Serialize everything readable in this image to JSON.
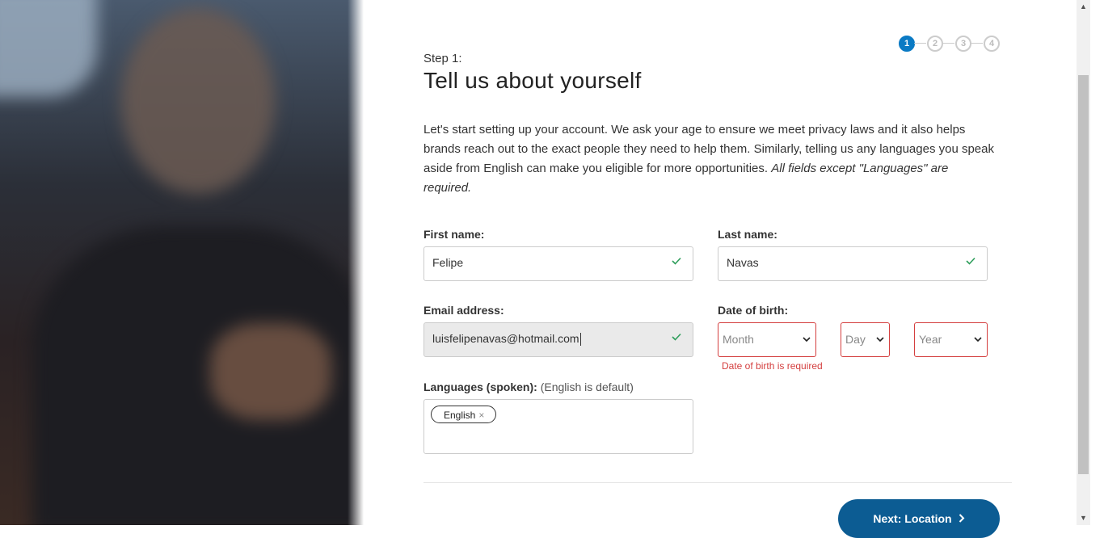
{
  "stepper": {
    "steps": [
      "1",
      "2",
      "3",
      "4"
    ],
    "active": 1
  },
  "header": {
    "step_label": "Step 1:",
    "title": "Tell us about yourself"
  },
  "intro": {
    "text": "Let's start setting up your account. We ask your age to ensure we meet privacy laws and it also helps brands reach out to the exact people they need to help them. Similarly, telling us any languages you speak aside from English can make you eligible for more opportunities.",
    "emphasis": "All fields except \"Languages\" are required."
  },
  "form": {
    "first_name": {
      "label": "First name:",
      "value": "Felipe"
    },
    "last_name": {
      "label": "Last name:",
      "value": "Navas"
    },
    "email": {
      "label": "Email address:",
      "value": "luisfelipenavas@hotmail.com"
    },
    "dob": {
      "label": "Date of birth:",
      "month": "Month",
      "day": "Day",
      "year": "Year",
      "error": "Date of birth is required"
    },
    "languages": {
      "label": "Languages (spoken):",
      "hint": "(English is default)",
      "tags": [
        "English"
      ],
      "remove_glyph": "×"
    }
  },
  "actions": {
    "next_label": "Next: Location"
  },
  "colors": {
    "accent": "#0a7ac4",
    "button": "#0c5c93",
    "error": "#d43f3f",
    "valid": "#2e9e5b"
  },
  "icons": [
    "check-icon",
    "chevron-down-icon",
    "chevron-right-icon",
    "scroll-up-icon",
    "scroll-down-icon"
  ]
}
